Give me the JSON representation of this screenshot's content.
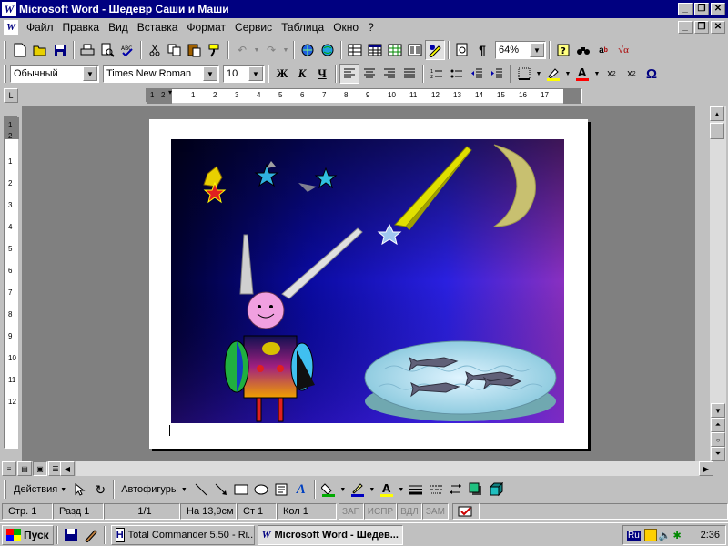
{
  "window": {
    "title": "Microsoft Word - Шедевр Саши и Маши",
    "app_icon": "W",
    "minimize": "_",
    "restore": "❐",
    "close": "✕"
  },
  "menu": {
    "items": [
      "Файл",
      "Правка",
      "Вид",
      "Вставка",
      "Формат",
      "Сервис",
      "Таблица",
      "Окно",
      "?"
    ]
  },
  "standard_toolbar": {
    "zoom": "64%",
    "paragraph_mark": "¶"
  },
  "format_toolbar": {
    "style": "Обычный",
    "font": "Times New Roman",
    "size": "10",
    "bold": "Ж",
    "italic": "К",
    "underline": "Ч"
  },
  "ruler": {
    "h_labels": [
      "1",
      "2",
      "1",
      "2",
      "3",
      "4",
      "5",
      "6",
      "7",
      "8",
      "9",
      "10",
      "11",
      "12",
      "13",
      "14",
      "15",
      "16",
      "17"
    ],
    "v_labels": [
      "1",
      "2",
      "1",
      "2",
      "3",
      "4",
      "5",
      "6",
      "7",
      "8",
      "9",
      "10",
      "11",
      "12"
    ]
  },
  "drawing_toolbar": {
    "actions": "Действия",
    "autoshapes": "Автофигуры"
  },
  "status": {
    "page": "Стр. 1",
    "section": "Разд 1",
    "pages": "1/1",
    "position": "На 13,9см",
    "line": "Ст 1",
    "column": "Кол 1",
    "modes": [
      "ЗАП",
      "ИСПР",
      "ВДЛ",
      "ЗАМ"
    ]
  },
  "taskbar": {
    "start": "Пуск",
    "tasks": [
      "Total Commander 5.50 - Ri...",
      "Microsoft Word - Шедев..."
    ],
    "lang": "Ru",
    "clock": "2:36"
  },
  "colors": {
    "titlebar": "#000080",
    "sky_top": "#000000",
    "sky_mid": "#1010c8",
    "sky_right": "#8030c0",
    "moon": "#c8c070",
    "comet": "#e0e000",
    "robot_face": "#f0a0e0",
    "pond": "#a0d8e8"
  }
}
